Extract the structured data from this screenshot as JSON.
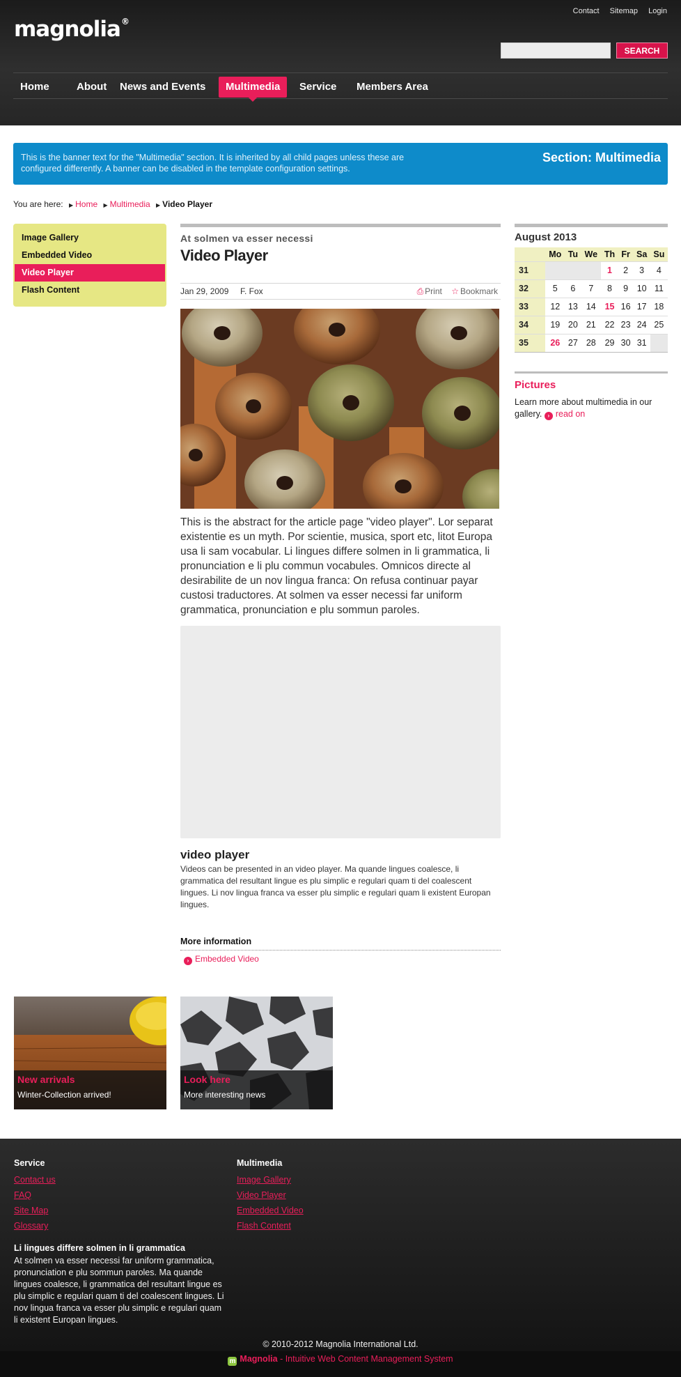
{
  "header": {
    "logo_text": "magnolia",
    "logo_reg": "®",
    "top_links": [
      "Contact",
      "Sitemap",
      "Login"
    ],
    "search": {
      "placeholder": "",
      "button_label": "SEARCH"
    },
    "nav": [
      "Home",
      "About",
      "News and Events",
      "Multimedia",
      "Service",
      "Members Area"
    ],
    "nav_active": "Multimedia"
  },
  "banner": {
    "text": "This is the banner text for the \"Multimedia\" section. It is inherited by all child pages unless these are configured differently. A banner can be disabled in the template configuration settings.",
    "title": "Section: Multimedia"
  },
  "breadcrumb": {
    "label": "You are here:",
    "items": [
      "Home",
      "Multimedia"
    ],
    "current": "Video Player"
  },
  "subnav": {
    "items": [
      "Image Gallery",
      "Embedded Video",
      "Video Player",
      "Flash Content"
    ],
    "active": "Video Player"
  },
  "article": {
    "kicker": "At solmen va esser necessi",
    "title": "Video Player",
    "date": "Jan 29, 2009",
    "author": "F. Fox",
    "print_label": "Print",
    "bookmark_label": "Bookmark",
    "abstract": "This is the abstract for the article page \"video player\". Lor separat existentie es un myth. Por scientie, musica, sport etc, litot Europa usa li sam vocabular. Li lingues differe solmen in li grammatica, li pronunciation e li plu commun vocabules. Omnicos directe al desirabilite de un nov lingua franca: On refusa continuar payar custosi traductores. At solmen va esser necessi far uniform grammatica, pronunciation e plu sommun paroles.",
    "video_title": "video player",
    "video_desc": "Videos can be presented in an video player. Ma quande lingues coalesce, li grammatica del resultant lingue es plu simplic e regulari quam ti del coalescent lingues. Li nov lingua franca va esser plu simplic e regulari quam li existent Europan lingues.",
    "more_title": "More information",
    "more_link": "Embedded Video"
  },
  "calendar": {
    "title": "August 2013",
    "days": [
      "Mo",
      "Tu",
      "We",
      "Th",
      "Fr",
      "Sa",
      "Su"
    ],
    "weeks": [
      {
        "wk": "31",
        "d": [
          "",
          "",
          "",
          "1",
          "2",
          "3",
          "4"
        ]
      },
      {
        "wk": "32",
        "d": [
          "5",
          "6",
          "7",
          "8",
          "9",
          "10",
          "11"
        ]
      },
      {
        "wk": "33",
        "d": [
          "12",
          "13",
          "14",
          "15",
          "16",
          "17",
          "18"
        ]
      },
      {
        "wk": "34",
        "d": [
          "19",
          "20",
          "21",
          "22",
          "23",
          "24",
          "25"
        ]
      },
      {
        "wk": "35",
        "d": [
          "26",
          "27",
          "28",
          "29",
          "30",
          "31",
          ""
        ]
      }
    ],
    "highlighted": [
      "1",
      "15",
      "26"
    ]
  },
  "pictures": {
    "title": "Pictures",
    "text": "Learn more about multimedia in our gallery.",
    "link": "read on"
  },
  "teasers": [
    {
      "title": "New arrivals",
      "subtitle": "Winter-Collection arrived!"
    },
    {
      "title": "Look here",
      "subtitle": "More interesting news"
    }
  ],
  "footer": {
    "col1": {
      "title": "Service",
      "links": [
        "Contact us",
        "FAQ",
        "Site Map",
        "Glossary"
      ]
    },
    "col2": {
      "title": "Multimedia",
      "links": [
        "Image Gallery",
        "Video Player",
        "Embedded Video",
        "Flash Content"
      ]
    },
    "about_title": "Li lingues differe solmen in li grammatica",
    "about_text": "At solmen va esser necessi far uniform grammatica, pronunciation e plu sommun paroles. Ma quande lingues coalesce, li grammatica del resultant lingue es plu simplic e regulari quam ti del coalescent lingues. Li nov lingua franca va esser plu simplic e regulari quam li existent Europan lingues.",
    "copyright": "© 2010-2012 Magnolia International Ltd.",
    "powered_brand": "Magnolia",
    "powered_text": " - Intuitive Web Content Management System"
  },
  "colors": {
    "accent": "#e91e5a",
    "banner": "#0e8bca",
    "subnav_bg": "#e6e784"
  }
}
